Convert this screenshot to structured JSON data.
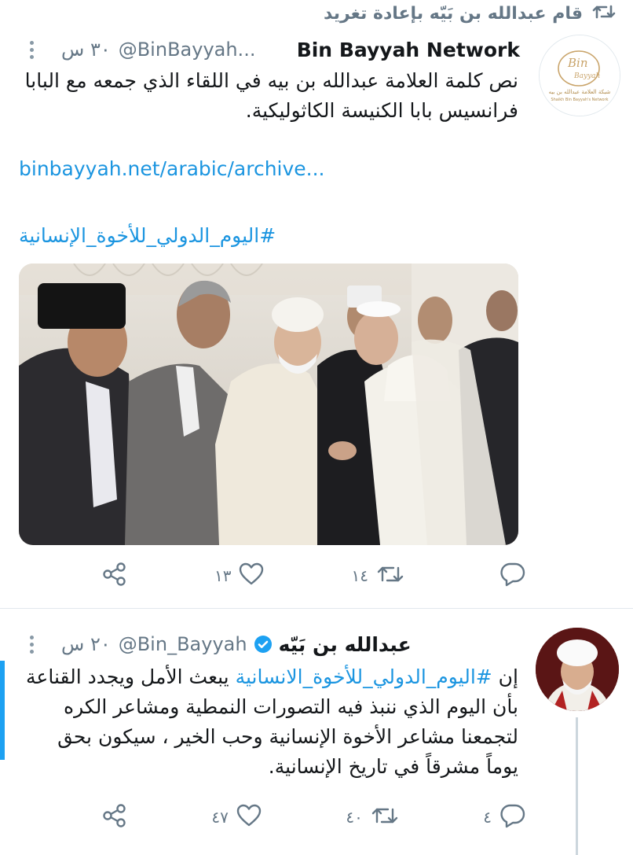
{
  "retweet_header": {
    "text": "قام عبدالله بن بَيّه بإعادة تغريد"
  },
  "tweet1": {
    "display_name": "Bin Bayyah Network",
    "handle": "@BinBayyah...",
    "time": "٣٠ س",
    "text": "نص كلمة العلامة عبدالله بن بيه في اللقاء الذي جمعه مع البابا فرانسيس بابا الكنيسة الكاثوليكية.",
    "link": "binbayyah.net/arabic/archive...",
    "hashtag": "#اليوم_الدولي_للأخوة_الإنسانية",
    "avatar_logo": {
      "line1": "Bin",
      "line2": "Bayyah",
      "caption_ar": "شبكة العلامة عبدالله بن بيه",
      "caption_en": "Shaikh Bin Bayyah's Network"
    },
    "replies": "",
    "retweets": "١٤",
    "likes": "١٣"
  },
  "tweet2": {
    "display_name": "عبدالله بن بَيّه",
    "handle": "@Bin_Bayyah",
    "time": "٢٠ س",
    "text_prefix": "إن ",
    "hashtag": "#اليوم_الدولي_للأخوة_الانسانية",
    "text_rest": " يبعث الأمل ويجدد القناعة بأن اليوم الذي ننبذ فيه التصورات النمطية ومشاعر الكره لتجمعنا مشاعر الأخوة الإنسانية وحب الخير ، سيكون بحق يوماً مشرقاً في تاريخ الإنسانية.",
    "replies": "٤",
    "retweets": "٤٠",
    "likes": "٤٧"
  },
  "colors": {
    "link": "#1b95e0",
    "verified": "#1da1f2",
    "muted": "#657786",
    "accent": "#1da1f2"
  },
  "icons": [
    "retweet-icon",
    "more-icon",
    "verified-icon",
    "reply-icon",
    "like-icon",
    "share-icon"
  ]
}
